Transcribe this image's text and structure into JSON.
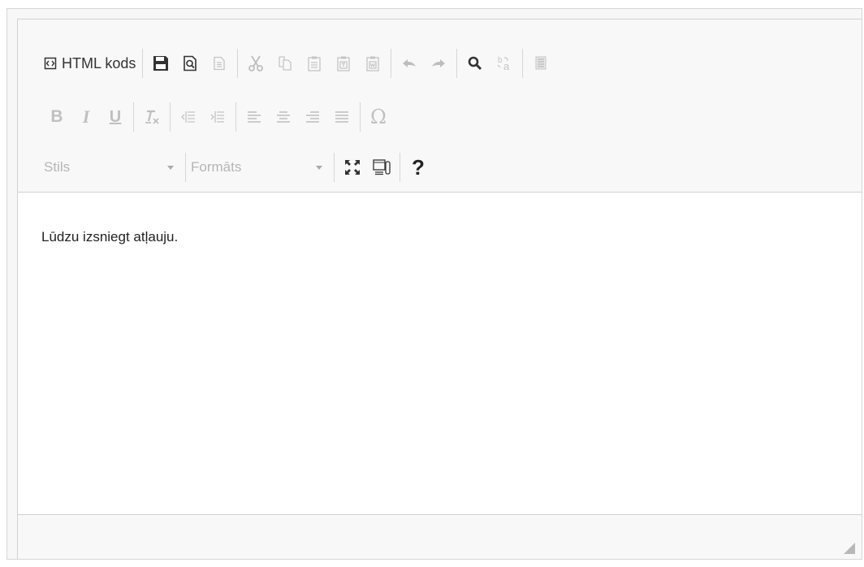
{
  "toolbar": {
    "source_label": "HTML kods",
    "style_combo": "Stils",
    "format_combo": "Formāts",
    "help_label": "?",
    "special_char_label": "Ω"
  },
  "content": {
    "text": "Lūdzu izsniegt atļauju."
  },
  "colors": {
    "enabled_icon": "#333333",
    "disabled_icon": "#bdbdbd",
    "border": "#d1d1d1"
  }
}
